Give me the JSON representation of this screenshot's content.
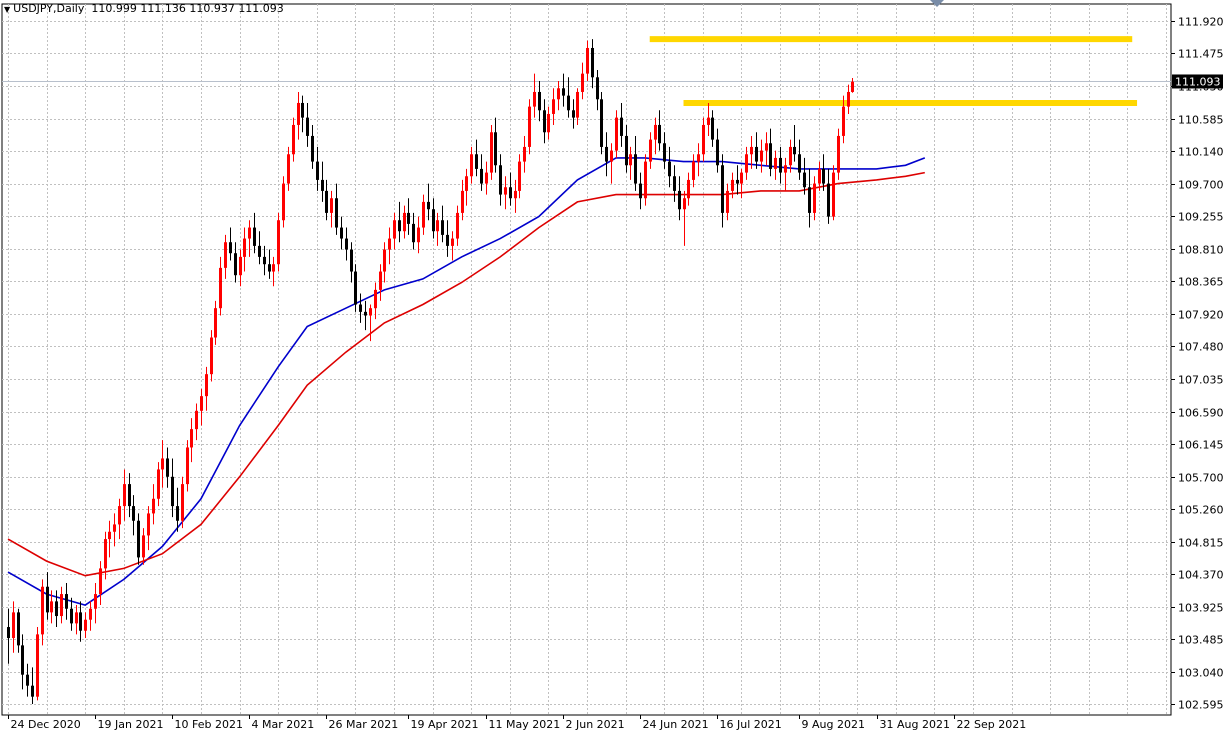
{
  "header": {
    "symbol": "USDJPY,Daily",
    "ohlc": "110.999 111.136 110.937 111.093"
  },
  "price_tag": "111.093",
  "chart_data": {
    "type": "candlestick",
    "title": "USDJPY,Daily",
    "y_ticks": [
      "111.920",
      "111.475",
      "111.030",
      "110.585",
      "110.140",
      "109.700",
      "109.255",
      "108.810",
      "108.365",
      "107.920",
      "107.480",
      "107.035",
      "106.590",
      "106.145",
      "105.700",
      "105.260",
      "104.815",
      "104.370",
      "103.925",
      "103.485",
      "103.040",
      "102.595"
    ],
    "ylim": [
      102.45,
      112.15
    ],
    "x_ticks": [
      {
        "label": "24 Dec 2020",
        "index": 0
      },
      {
        "label": "19 Jan 2021",
        "index": 18
      },
      {
        "label": "10 Feb 2021",
        "index": 34
      },
      {
        "label": "4 Mar 2021",
        "index": 50
      },
      {
        "label": "26 Mar 2021",
        "index": 66
      },
      {
        "label": "19 Apr 2021",
        "index": 83
      },
      {
        "label": "11 May 2021",
        "index": 99
      },
      {
        "label": "2 Jun 2021",
        "index": 115
      },
      {
        "label": "24 Jun 2021",
        "index": 131
      },
      {
        "label": "16 Jul 2021",
        "index": 147
      },
      {
        "label": "9 Aug 2021",
        "index": 164
      },
      {
        "label": "31 Aug 2021",
        "index": 180
      },
      {
        "label": "22 Sep 2021",
        "index": 196
      }
    ],
    "last_price": 111.093,
    "horizontal_levels": [
      {
        "from_index": 133,
        "to_index": 233,
        "value": 111.67,
        "color": "#ffd700"
      },
      {
        "from_index": 140,
        "to_index": 234,
        "value": 110.8,
        "color": "#ffd700"
      }
    ],
    "candles": [
      [
        103.65,
        103.9,
        103.15,
        103.5
      ],
      [
        103.5,
        104.0,
        103.3,
        103.85
      ],
      [
        103.85,
        103.9,
        103.3,
        103.4
      ],
      [
        103.4,
        103.55,
        102.8,
        103.0
      ],
      [
        103.0,
        103.15,
        102.7,
        102.85
      ],
      [
        102.85,
        103.1,
        102.6,
        102.7
      ],
      [
        102.7,
        103.65,
        102.65,
        103.55
      ],
      [
        103.55,
        104.3,
        103.4,
        104.2
      ],
      [
        104.2,
        104.4,
        103.75,
        103.85
      ],
      [
        103.85,
        104.15,
        103.7,
        104.0
      ],
      [
        104.0,
        104.15,
        103.65,
        103.8
      ],
      [
        103.8,
        104.2,
        103.7,
        104.1
      ],
      [
        104.1,
        104.25,
        103.75,
        103.9
      ],
      [
        103.9,
        104.05,
        103.6,
        103.7
      ],
      [
        103.7,
        103.95,
        103.55,
        103.85
      ],
      [
        103.85,
        104.0,
        103.45,
        103.6
      ],
      [
        103.6,
        103.85,
        103.5,
        103.75
      ],
      [
        103.75,
        104.0,
        103.6,
        103.9
      ],
      [
        103.9,
        104.25,
        103.7,
        104.1
      ],
      [
        104.1,
        104.55,
        103.95,
        104.45
      ],
      [
        104.45,
        104.95,
        104.3,
        104.85
      ],
      [
        104.85,
        105.1,
        104.6,
        104.95
      ],
      [
        104.95,
        105.2,
        104.75,
        105.05
      ],
      [
        105.05,
        105.4,
        104.85,
        105.3
      ],
      [
        105.3,
        105.8,
        105.1,
        105.6
      ],
      [
        105.6,
        105.75,
        105.15,
        105.3
      ],
      [
        105.3,
        105.45,
        104.9,
        105.1
      ],
      [
        105.1,
        105.2,
        104.5,
        104.6
      ],
      [
        104.6,
        105.0,
        104.5,
        104.9
      ],
      [
        104.9,
        105.3,
        104.7,
        105.2
      ],
      [
        105.2,
        105.6,
        105.05,
        105.4
      ],
      [
        105.4,
        105.9,
        105.3,
        105.8
      ],
      [
        105.8,
        106.2,
        105.55,
        105.95
      ],
      [
        105.95,
        106.1,
        105.55,
        105.7
      ],
      [
        105.7,
        105.95,
        105.15,
        105.3
      ],
      [
        105.3,
        105.55,
        104.95,
        105.1
      ],
      [
        105.1,
        105.7,
        105.0,
        105.6
      ],
      [
        105.6,
        106.2,
        105.5,
        106.1
      ],
      [
        106.1,
        106.5,
        105.9,
        106.35
      ],
      [
        106.35,
        106.7,
        106.2,
        106.6
      ],
      [
        106.6,
        106.9,
        106.4,
        106.8
      ],
      [
        106.8,
        107.2,
        106.6,
        107.1
      ],
      [
        107.1,
        107.7,
        107.0,
        107.6
      ],
      [
        107.6,
        108.1,
        107.5,
        108.0
      ],
      [
        108.0,
        108.7,
        107.9,
        108.55
      ],
      [
        108.55,
        109.0,
        108.4,
        108.9
      ],
      [
        108.9,
        109.1,
        108.65,
        108.75
      ],
      [
        108.75,
        108.9,
        108.35,
        108.45
      ],
      [
        108.45,
        108.8,
        108.3,
        108.7
      ],
      [
        108.7,
        109.1,
        108.5,
        108.95
      ],
      [
        108.95,
        109.2,
        108.7,
        109.1
      ],
      [
        109.1,
        109.3,
        108.75,
        108.85
      ],
      [
        108.85,
        109.05,
        108.6,
        108.7
      ],
      [
        108.7,
        108.85,
        108.45,
        108.6
      ],
      [
        108.6,
        108.8,
        108.4,
        108.5
      ],
      [
        108.5,
        108.7,
        108.3,
        108.6
      ],
      [
        108.6,
        109.3,
        108.5,
        109.2
      ],
      [
        109.2,
        109.8,
        109.1,
        109.7
      ],
      [
        109.7,
        110.2,
        109.6,
        110.1
      ],
      [
        110.1,
        110.6,
        110.0,
        110.5
      ],
      [
        110.5,
        110.95,
        110.3,
        110.8
      ],
      [
        110.8,
        110.9,
        110.4,
        110.6
      ],
      [
        110.6,
        110.8,
        110.2,
        110.35
      ],
      [
        110.35,
        110.5,
        109.9,
        110.0
      ],
      [
        110.0,
        110.2,
        109.6,
        109.75
      ],
      [
        109.75,
        110.0,
        109.45,
        109.6
      ],
      [
        109.6,
        109.75,
        109.2,
        109.3
      ],
      [
        109.3,
        109.6,
        109.1,
        109.5
      ],
      [
        109.5,
        109.7,
        109.0,
        109.1
      ],
      [
        109.1,
        109.25,
        108.8,
        108.95
      ],
      [
        108.95,
        109.1,
        108.65,
        108.8
      ],
      [
        108.8,
        108.9,
        108.35,
        108.5
      ],
      [
        108.5,
        108.6,
        107.95,
        108.05
      ],
      [
        108.05,
        108.2,
        107.8,
        107.95
      ],
      [
        107.95,
        108.1,
        107.7,
        107.9
      ],
      [
        107.9,
        108.05,
        107.55,
        108.0
      ],
      [
        108.0,
        108.35,
        107.85,
        108.25
      ],
      [
        108.25,
        108.6,
        108.1,
        108.5
      ],
      [
        108.5,
        108.9,
        108.35,
        108.8
      ],
      [
        108.8,
        109.1,
        108.6,
        108.95
      ],
      [
        108.95,
        109.3,
        108.8,
        109.2
      ],
      [
        109.2,
        109.45,
        108.9,
        109.05
      ],
      [
        109.05,
        109.4,
        108.95,
        109.3
      ],
      [
        109.3,
        109.5,
        109.0,
        109.15
      ],
      [
        109.15,
        109.3,
        108.8,
        108.9
      ],
      [
        108.9,
        109.25,
        108.75,
        109.1
      ],
      [
        109.1,
        109.55,
        109.0,
        109.45
      ],
      [
        109.45,
        109.7,
        109.2,
        109.35
      ],
      [
        109.35,
        109.5,
        108.95,
        109.05
      ],
      [
        109.05,
        109.3,
        108.85,
        109.2
      ],
      [
        109.2,
        109.4,
        108.9,
        109.0
      ],
      [
        109.0,
        109.2,
        108.7,
        108.85
      ],
      [
        108.85,
        109.05,
        108.65,
        108.95
      ],
      [
        108.95,
        109.4,
        108.85,
        109.3
      ],
      [
        109.3,
        109.75,
        109.2,
        109.6
      ],
      [
        109.6,
        109.9,
        109.4,
        109.8
      ],
      [
        109.8,
        110.2,
        109.7,
        110.1
      ],
      [
        110.1,
        110.3,
        109.8,
        109.9
      ],
      [
        109.9,
        110.1,
        109.6,
        109.7
      ],
      [
        109.7,
        110.0,
        109.55,
        109.85
      ],
      [
        109.85,
        110.5,
        109.75,
        110.4
      ],
      [
        110.4,
        110.6,
        109.85,
        109.95
      ],
      [
        109.95,
        110.1,
        109.4,
        109.55
      ],
      [
        109.55,
        109.8,
        109.35,
        109.65
      ],
      [
        109.65,
        109.85,
        109.4,
        109.5
      ],
      [
        109.5,
        109.75,
        109.3,
        109.6
      ],
      [
        109.6,
        110.1,
        109.5,
        110.0
      ],
      [
        110.0,
        110.35,
        109.85,
        110.2
      ],
      [
        110.2,
        110.85,
        110.1,
        110.75
      ],
      [
        110.75,
        111.2,
        110.6,
        110.95
      ],
      [
        110.95,
        111.1,
        110.55,
        110.7
      ],
      [
        110.7,
        110.85,
        110.25,
        110.4
      ],
      [
        110.4,
        110.75,
        110.3,
        110.65
      ],
      [
        110.65,
        111.0,
        110.5,
        110.85
      ],
      [
        110.85,
        111.1,
        110.7,
        111.0
      ],
      [
        111.0,
        111.2,
        110.75,
        110.9
      ],
      [
        110.9,
        111.15,
        110.6,
        110.7
      ],
      [
        110.7,
        110.85,
        110.45,
        110.6
      ],
      [
        110.6,
        111.0,
        110.5,
        110.95
      ],
      [
        110.95,
        111.35,
        110.85,
        111.2
      ],
      [
        111.2,
        111.65,
        111.1,
        111.55
      ],
      [
        111.55,
        111.67,
        111.0,
        111.15
      ],
      [
        111.15,
        111.25,
        110.7,
        110.85
      ],
      [
        110.85,
        110.95,
        110.1,
        110.2
      ],
      [
        110.2,
        110.4,
        109.8,
        110.0
      ],
      [
        110.0,
        110.25,
        109.7,
        110.15
      ],
      [
        110.15,
        110.7,
        110.05,
        110.6
      ],
      [
        110.6,
        110.8,
        110.2,
        110.35
      ],
      [
        110.35,
        110.5,
        109.85,
        109.95
      ],
      [
        109.95,
        110.2,
        109.75,
        110.1
      ],
      [
        110.1,
        110.35,
        109.6,
        109.7
      ],
      [
        109.7,
        109.85,
        109.35,
        109.5
      ],
      [
        109.5,
        110.1,
        109.4,
        110.0
      ],
      [
        110.0,
        110.4,
        109.9,
        110.3
      ],
      [
        110.3,
        110.6,
        110.1,
        110.5
      ],
      [
        110.5,
        110.7,
        110.15,
        110.25
      ],
      [
        110.25,
        110.4,
        109.9,
        110.0
      ],
      [
        110.0,
        110.2,
        109.65,
        109.8
      ],
      [
        109.8,
        109.95,
        109.45,
        109.6
      ],
      [
        109.6,
        109.8,
        109.2,
        109.35
      ],
      [
        109.35,
        109.6,
        108.85,
        109.5
      ],
      [
        109.5,
        109.85,
        109.4,
        109.75
      ],
      [
        109.75,
        110.1,
        109.65,
        110.0
      ],
      [
        110.0,
        110.25,
        109.8,
        110.1
      ],
      [
        110.1,
        110.6,
        110.0,
        110.5
      ],
      [
        110.5,
        110.8,
        110.35,
        110.6
      ],
      [
        110.6,
        110.7,
        110.2,
        110.3
      ],
      [
        110.3,
        110.45,
        109.85,
        109.95
      ],
      [
        109.95,
        110.1,
        109.1,
        109.3
      ],
      [
        109.3,
        109.7,
        109.2,
        109.6
      ],
      [
        109.6,
        109.85,
        109.5,
        109.75
      ],
      [
        109.75,
        109.95,
        109.55,
        109.7
      ],
      [
        109.7,
        109.9,
        109.5,
        109.85
      ],
      [
        109.85,
        110.2,
        109.75,
        110.1
      ],
      [
        110.1,
        110.35,
        109.9,
        110.2
      ],
      [
        110.2,
        110.4,
        109.9,
        110.0
      ],
      [
        110.0,
        110.3,
        109.85,
        110.15
      ],
      [
        110.15,
        110.4,
        109.95,
        110.25
      ],
      [
        110.25,
        110.45,
        109.8,
        109.9
      ],
      [
        109.9,
        110.15,
        109.75,
        110.05
      ],
      [
        110.05,
        110.2,
        109.7,
        109.85
      ],
      [
        109.85,
        110.05,
        109.6,
        109.95
      ],
      [
        109.95,
        110.3,
        109.85,
        110.2
      ],
      [
        110.2,
        110.5,
        110.0,
        110.1
      ],
      [
        110.1,
        110.3,
        109.75,
        109.85
      ],
      [
        109.85,
        110.05,
        109.55,
        109.65
      ],
      [
        109.65,
        109.9,
        109.1,
        109.3
      ],
      [
        109.3,
        109.8,
        109.2,
        109.7
      ],
      [
        109.7,
        110.0,
        109.6,
        109.9
      ],
      [
        109.9,
        110.1,
        109.6,
        109.7
      ],
      [
        109.7,
        109.9,
        109.15,
        109.25
      ],
      [
        109.25,
        109.95,
        109.2,
        109.85
      ],
      [
        109.85,
        110.45,
        109.75,
        110.35
      ],
      [
        110.35,
        110.9,
        110.25,
        110.75
      ],
      [
        110.75,
        111.05,
        110.65,
        110.95
      ],
      [
        110.95,
        111.14,
        110.94,
        111.09
      ]
    ],
    "series": [
      {
        "name": "",
        "color": "#0000cc",
        "points": [
          [
            0,
            104.4
          ],
          [
            8,
            104.1
          ],
          [
            16,
            103.95
          ],
          [
            24,
            104.3
          ],
          [
            32,
            104.75
          ],
          [
            40,
            105.4
          ],
          [
            48,
            106.4
          ],
          [
            56,
            107.2
          ],
          [
            62,
            107.75
          ],
          [
            70,
            108.0
          ],
          [
            78,
            108.25
          ],
          [
            86,
            108.4
          ],
          [
            94,
            108.7
          ],
          [
            102,
            108.95
          ],
          [
            110,
            109.25
          ],
          [
            118,
            109.75
          ],
          [
            126,
            110.05
          ],
          [
            132,
            110.05
          ],
          [
            140,
            110.0
          ],
          [
            148,
            110.0
          ],
          [
            156,
            109.95
          ],
          [
            164,
            109.9
          ],
          [
            172,
            109.9
          ],
          [
            180,
            109.9
          ],
          [
            186,
            109.95
          ],
          [
            190,
            110.05
          ]
        ]
      },
      {
        "name": "",
        "color": "#dd0000",
        "points": [
          [
            0,
            104.85
          ],
          [
            8,
            104.55
          ],
          [
            16,
            104.35
          ],
          [
            24,
            104.45
          ],
          [
            32,
            104.65
          ],
          [
            40,
            105.05
          ],
          [
            48,
            105.7
          ],
          [
            56,
            106.4
          ],
          [
            62,
            106.95
          ],
          [
            70,
            107.4
          ],
          [
            78,
            107.8
          ],
          [
            86,
            108.05
          ],
          [
            94,
            108.35
          ],
          [
            102,
            108.7
          ],
          [
            110,
            109.1
          ],
          [
            118,
            109.45
          ],
          [
            126,
            109.55
          ],
          [
            132,
            109.55
          ],
          [
            140,
            109.55
          ],
          [
            148,
            109.55
          ],
          [
            156,
            109.6
          ],
          [
            164,
            109.6
          ],
          [
            172,
            109.7
          ],
          [
            180,
            109.75
          ],
          [
            186,
            109.8
          ],
          [
            190,
            109.85
          ]
        ]
      }
    ],
    "colors": {
      "bull": "#ff0000",
      "bear": "#000000",
      "grid": "#c0c0c0",
      "tag_bg": "#000000",
      "tag_fg": "#ffffff"
    }
  }
}
